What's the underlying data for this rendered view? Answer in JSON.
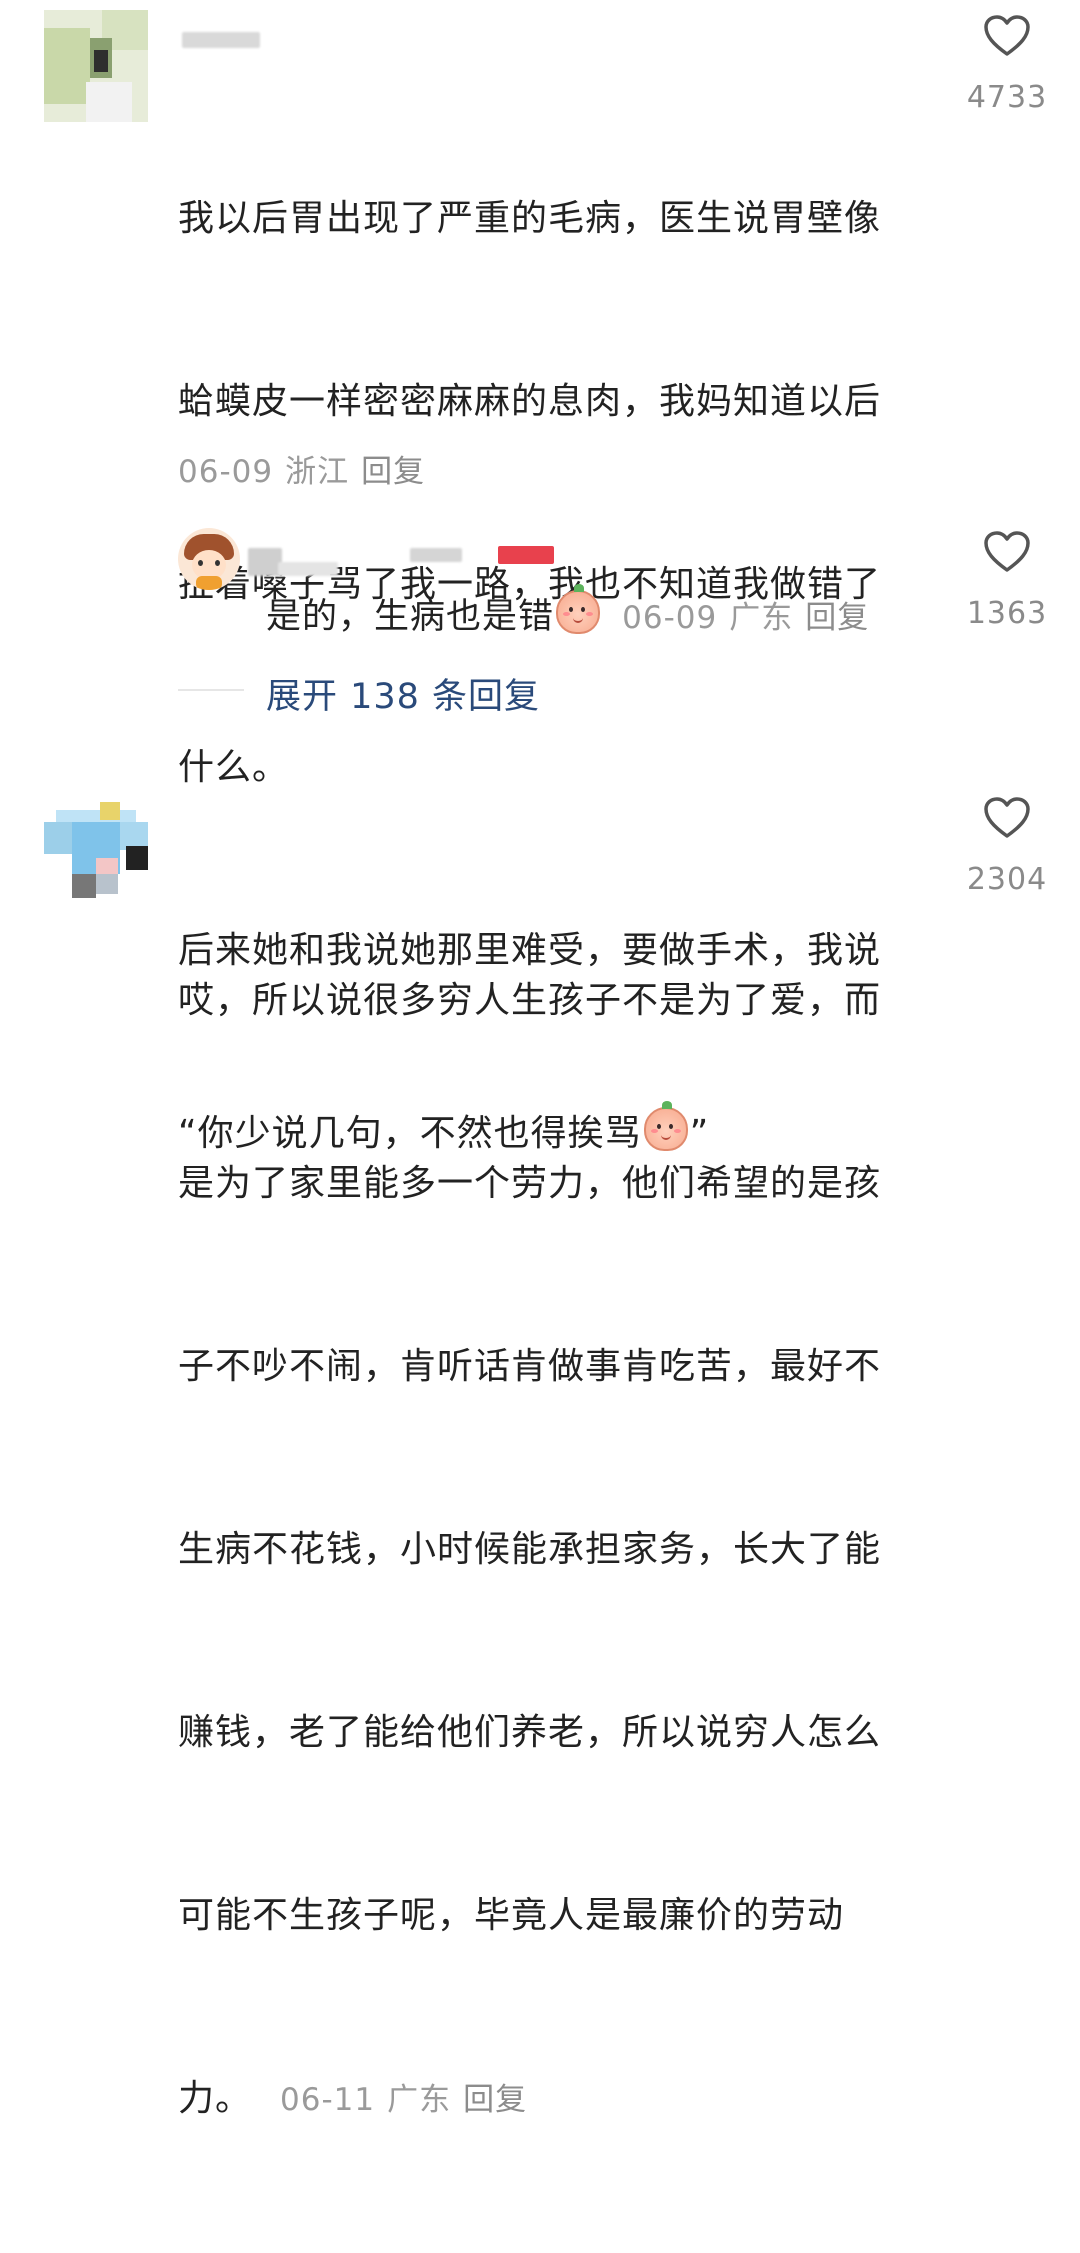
{
  "comments": [
    {
      "text_lines": [
        "我以后胃出现了严重的毛病，医生说胃壁像",
        "蛤蟆皮一样密密麻麻的息肉，我妈知道以后",
        "扯着嗓子骂了我一路，我也不知道我做错了",
        "什么。",
        "后来她和我说她那里难受，要做手术，我说",
        "“你少说几句，不然也得挨骂"
      ],
      "text_tail": "”",
      "emoji": "smiling-peach-emoji",
      "date": "06-09",
      "location": "浙江",
      "reply_label": "回复",
      "like_count": "4733",
      "sub_reply": {
        "text": "是的，生病也是错",
        "emoji": "smiling-peach-emoji",
        "date": "06-09",
        "location": "广东",
        "reply_label": "回复",
        "like_count": "1363"
      },
      "expand_label": "展开 138 条回复"
    },
    {
      "text_lines": [
        "哎，所以说很多穷人生孩子不是为了爱，而",
        "是为了家里能多一个劳力，他们希望的是孩",
        "子不吵不闹，肯听话肯做事肯吃苦，最好不",
        "生病不花钱，小时候能承担家务，长大了能",
        "赚钱，老了能给他们养老，所以说穷人怎么",
        "可能不生孩子呢，毕竟人是最廉价的劳动"
      ],
      "last_line": "力。",
      "date": "06-11",
      "location": "广东",
      "reply_label": "回复",
      "like_count": "2304"
    }
  ],
  "icons": {
    "like": "heart-outline-icon"
  },
  "colors": {
    "text": "#222222",
    "meta": "#9a9a9a",
    "link": "#2a4a7a",
    "icon": "#555555"
  }
}
